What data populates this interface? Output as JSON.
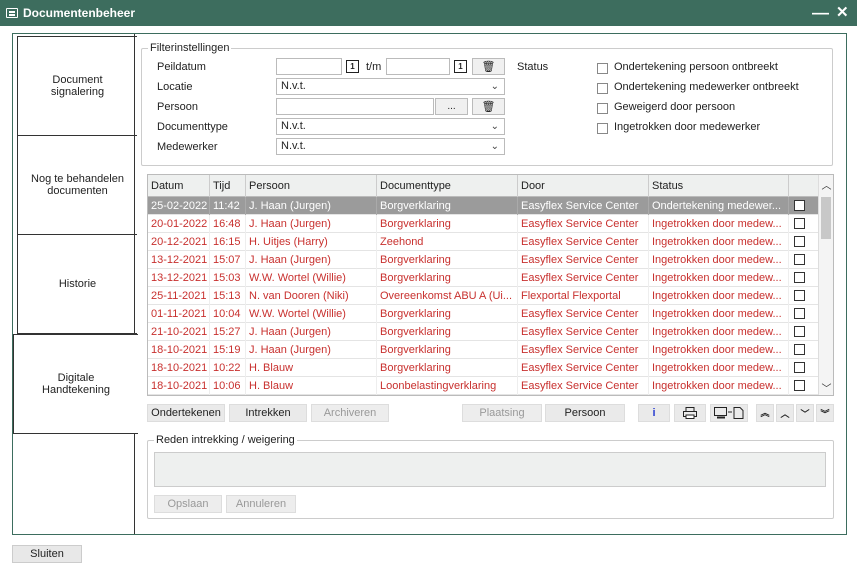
{
  "window": {
    "title": "Documentenbeheer",
    "minimize": "—",
    "close": "✕"
  },
  "sidebar": {
    "tabs": [
      {
        "label": "Document signalering"
      },
      {
        "label": "Nog te behandelen documenten"
      },
      {
        "label": "Historie"
      },
      {
        "label": "Digitale Handtekening"
      }
    ]
  },
  "filters": {
    "legend": "Filterinstellingen",
    "peildatum_label": "Peildatum",
    "peildatum_from": "",
    "tm_label": "t/m",
    "peildatum_to": "",
    "locatie_label": "Locatie",
    "locatie_value": "N.v.t.",
    "persoon_label": "Persoon",
    "persoon_value": "",
    "persoon_browse": "...",
    "documenttype_label": "Documenttype",
    "documenttype_value": "N.v.t.",
    "medewerker_label": "Medewerker",
    "medewerker_value": "N.v.t.",
    "status_label": "Status",
    "status_options": [
      "Ondertekening persoon ontbreekt",
      "Ondertekening medewerker ontbreekt",
      "Geweigerd door persoon",
      "Ingetrokken door medewerker"
    ]
  },
  "table": {
    "columns": [
      "Datum",
      "Tijd",
      "Persoon",
      "Documenttype",
      "Door",
      "Status"
    ],
    "rows": [
      [
        "25-02-2022",
        "11:42",
        "J. Haan (Jurgen)",
        "Borgverklaring",
        "Easyflex Service Center",
        "Ondertekening medewer..."
      ],
      [
        "20-01-2022",
        "16:48",
        "J. Haan (Jurgen)",
        "Borgverklaring",
        "Easyflex Service Center",
        "Ingetrokken door medew..."
      ],
      [
        "20-12-2021",
        "16:15",
        "H. Uitjes (Harry)",
        "Zeehond",
        "Easyflex Service Center",
        "Ingetrokken door medew..."
      ],
      [
        "13-12-2021",
        "15:07",
        "J. Haan (Jurgen)",
        "Borgverklaring",
        "Easyflex Service Center",
        "Ingetrokken door medew..."
      ],
      [
        "13-12-2021",
        "15:03",
        "W.W. Wortel (Willie)",
        "Borgverklaring",
        "Easyflex Service Center",
        "Ingetrokken door medew..."
      ],
      [
        "25-11-2021",
        "15:13",
        "N. van Dooren (Niki)",
        "Overeenkomst ABU A (Ui...",
        "Flexportal Flexportal",
        "Ingetrokken door medew..."
      ],
      [
        "01-11-2021",
        "10:04",
        "W.W. Wortel (Willie)",
        "Borgverklaring",
        "Easyflex Service Center",
        "Ingetrokken door medew..."
      ],
      [
        "21-10-2021",
        "15:27",
        "J. Haan (Jurgen)",
        "Borgverklaring",
        "Easyflex Service Center",
        "Ingetrokken door medew..."
      ],
      [
        "18-10-2021",
        "15:19",
        "J. Haan (Jurgen)",
        "Borgverklaring",
        "Easyflex Service Center",
        "Ingetrokken door medew..."
      ],
      [
        "18-10-2021",
        "10:22",
        "H. Blauw",
        "Borgverklaring",
        "Easyflex Service Center",
        "Ingetrokken door medew..."
      ],
      [
        "18-10-2021",
        "10:06",
        "H. Blauw",
        "Loonbelastingverklaring",
        "Easyflex Service Center",
        "Ingetrokken door medew..."
      ]
    ],
    "selected_row": 0
  },
  "actions": {
    "ondertekenen": "Ondertekenen",
    "intrekken": "Intrekken",
    "archiveren": "Archiveren",
    "plaatsing": "Plaatsing",
    "persoon": "Persoon",
    "info": "i"
  },
  "reason": {
    "legend": "Reden intrekking / weigering",
    "value": "",
    "save": "Opslaan",
    "cancel": "Annuleren"
  },
  "footer": {
    "close": "Sluiten"
  },
  "colors": {
    "titlebar": "#3d6d5e",
    "row_text": "#c8302e",
    "selected_row": "#9b9b9b"
  }
}
